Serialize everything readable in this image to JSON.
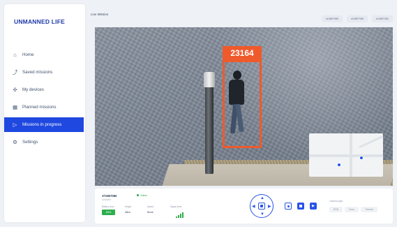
{
  "app": {
    "logo_text": "UNMANNED LIFE"
  },
  "sidebar": {
    "items": [
      {
        "label": "Home",
        "icon": "home-icon"
      },
      {
        "label": "Saved missions",
        "icon": "route-icon"
      },
      {
        "label": "My devices",
        "icon": "drone-icon"
      },
      {
        "label": "Planned missions",
        "icon": "calendar-icon"
      },
      {
        "label": "Missions in progress",
        "icon": "play-icon",
        "active": true
      },
      {
        "label": "Settings",
        "icon": "gear-icon"
      }
    ]
  },
  "header": {
    "title": "Live Mission",
    "drone_tabs": [
      "sf-0807080",
      "sf-0807180",
      "sf-0807181"
    ]
  },
  "video": {
    "detection_label": "23164",
    "detection_color": "#ef5a2c"
  },
  "panel": {
    "drone_id": "sf-0807080",
    "status": "Online",
    "sub_info": "4.5 Km/h",
    "battery_label": "Battery level",
    "battery_value": "80%",
    "height_label": "Height",
    "height_value": "48m",
    "speed_label": "Speed",
    "speed_value": "5m/s",
    "signal_label": "Signal level",
    "camera_label": "Camera type",
    "camera_modes": [
      "RGB",
      "Zoom",
      "Thermal"
    ]
  },
  "colors": {
    "accent": "#1f48e0",
    "online": "#2da34b",
    "battery": "#2fae4e"
  }
}
